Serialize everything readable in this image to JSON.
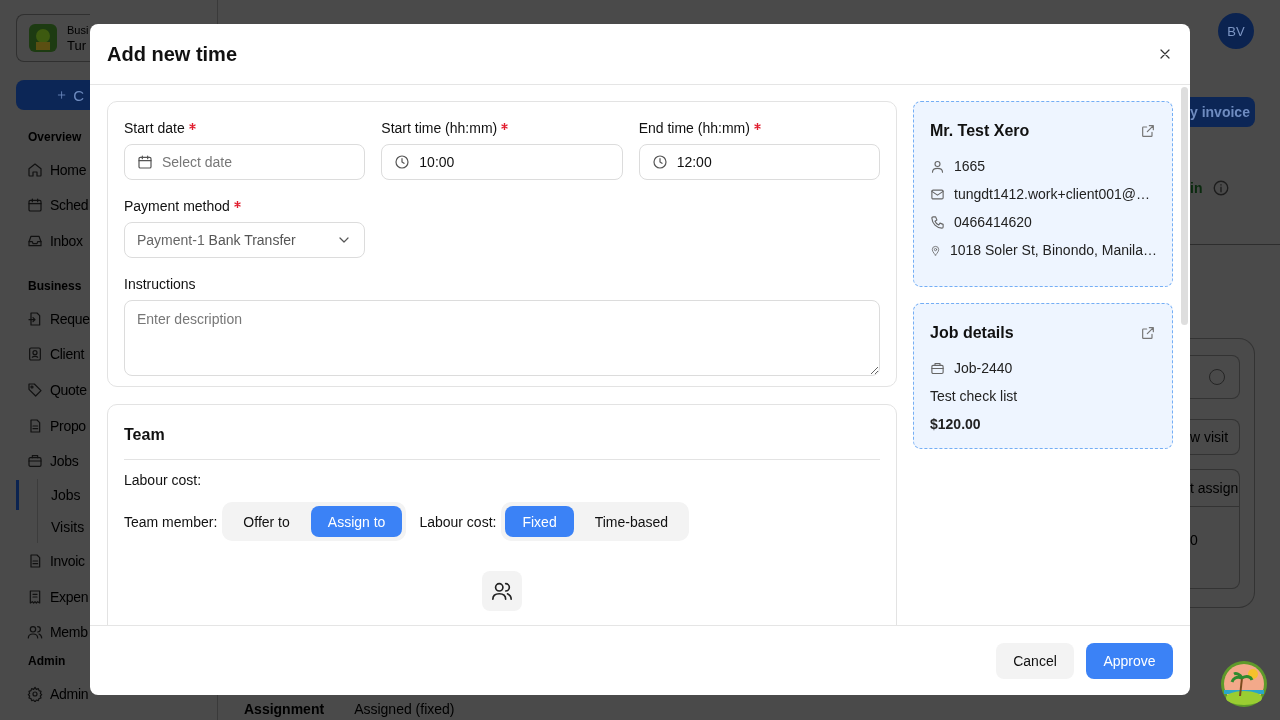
{
  "app": {
    "business": {
      "line_1": "Busi",
      "line_2": "Tur"
    },
    "create_button": "C",
    "sidebar": [
      {
        "title": "Overview",
        "items": [
          {
            "label": "Home"
          },
          {
            "label": "Sched"
          },
          {
            "label": "Inbox"
          }
        ]
      },
      {
        "title": "Business",
        "items": [
          {
            "label": "Reque"
          },
          {
            "label": "Client"
          },
          {
            "label": "Quote"
          },
          {
            "label": "Propo"
          },
          {
            "label": "Jobs",
            "children": [
              {
                "label": "Jobs",
                "selected": true
              },
              {
                "label": "Visits",
                "selected": false
              }
            ]
          },
          {
            "label": "Invoic"
          },
          {
            "label": "Expen"
          },
          {
            "label": "Memb"
          }
        ]
      },
      {
        "title": "Admin",
        "items": [
          {
            "label": "Admin"
          }
        ]
      }
    ],
    "avatar": "BV",
    "invoice_button": "y invoice",
    "status": "in",
    "radio_selected": false,
    "visit_button": "w visit",
    "assign_header": "t assign",
    "assign_value": "0",
    "bottom_row": {
      "label": "Assignment",
      "value": "Assigned (fixed)"
    }
  },
  "modal": {
    "title": "Add new time",
    "fields": [
      {
        "kind": "date",
        "label": "Start date",
        "required": true,
        "placeholder": "Select date"
      },
      {
        "kind": "time",
        "label": "Start time (hh:mm)",
        "required": true,
        "value": "10:00"
      },
      {
        "kind": "time",
        "label": "End time (hh:mm)",
        "required": true,
        "value": "12:00"
      }
    ],
    "payment_method": {
      "label": "Payment method",
      "required": true,
      "code": "Payment-1",
      "value": "Bank Transfer"
    },
    "instructions": {
      "label": "Instructions",
      "placeholder": "Enter description"
    },
    "team": {
      "title": "Team",
      "labour_cost_label": "Labour cost:",
      "team_member_label": "Team member:",
      "team_member_options": [
        {
          "label": "Offer to",
          "selected": false
        },
        {
          "label": "Assign to",
          "selected": true
        }
      ],
      "cost_type_label": "Labour cost:",
      "cost_type_options": [
        {
          "label": "Fixed",
          "selected": true
        },
        {
          "label": "Time-based",
          "selected": false
        }
      ]
    },
    "client": {
      "name": "Mr. Test Xero",
      "details": [
        {
          "kind": "id",
          "text": "1665"
        },
        {
          "kind": "email",
          "text": "tungdt1412.work+client001@…"
        },
        {
          "kind": "phone",
          "text": "0466414620"
        },
        {
          "kind": "address",
          "text": "1018 Soler St, Binondo, Manila…"
        }
      ]
    },
    "job": {
      "title": "Job details",
      "number": "Job-2440",
      "description": "Test check list",
      "price": "$120.00"
    },
    "buttons": [
      {
        "kind": "secondary",
        "label": "Cancel"
      },
      {
        "kind": "primary",
        "label": "Approve"
      }
    ]
  }
}
